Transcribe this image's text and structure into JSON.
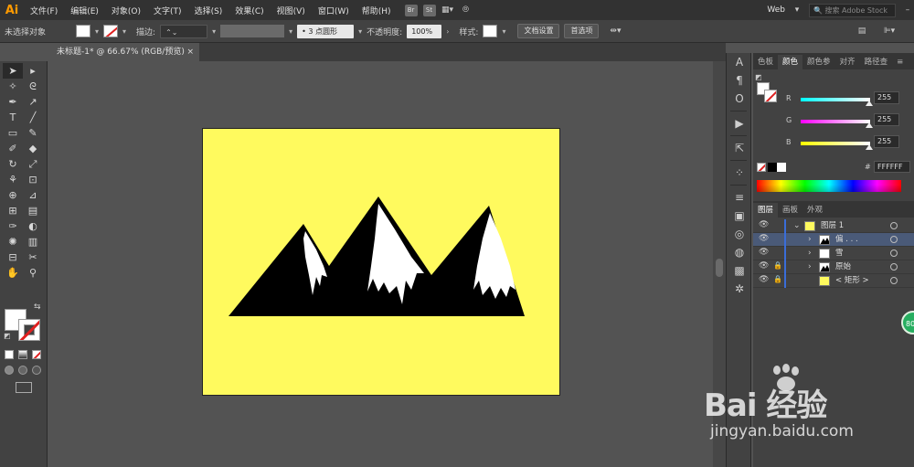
{
  "menubar": {
    "logo": "Ai",
    "items": [
      "文件(F)",
      "编辑(E)",
      "对象(O)",
      "文字(T)",
      "选择(S)",
      "效果(C)",
      "视图(V)",
      "窗口(W)",
      "帮助(H)"
    ],
    "bridge": "Br",
    "stock": "St",
    "workspace": "Web",
    "search_placeholder": "搜索 Adobe Stock"
  },
  "control_bar": {
    "selection_status": "未选择对象",
    "stroke_label": "描边:",
    "brush_value": "3 点圆形",
    "opacity_label": "不透明度:",
    "opacity_value": "100%",
    "style_label": "样式:",
    "doc_setup_button": "文档设置",
    "preferences_button": "首选项"
  },
  "document": {
    "tab_title": "未标题-1* @ 66.67% (RGB/预览)",
    "close_glyph": "×",
    "artboard_color": "#fffa5e",
    "shape_color": "#000000",
    "snow_color": "#ffffff"
  },
  "color_panel": {
    "tabs": [
      "色板",
      "颜色",
      "颜色参",
      "对齐",
      "路径查"
    ],
    "active_tab": "颜色",
    "channels": [
      {
        "label": "R",
        "value": "255",
        "track": "linear-gradient(to right,#00ffff,#ffffff)"
      },
      {
        "label": "G",
        "value": "255",
        "track": "linear-gradient(to right,#ff00ff,#ffffff)"
      },
      {
        "label": "B",
        "value": "255",
        "track": "linear-gradient(to right,#ffff00,#ffffff)"
      }
    ],
    "hex_label": "#",
    "hex_value": "FFFFFF"
  },
  "layers_panel": {
    "tabs": [
      "图层",
      "画板",
      "外观"
    ],
    "active_tab": "图层",
    "rows": [
      {
        "name": "图层 1",
        "indent": 0,
        "expanded": true,
        "locked": false,
        "selected": false
      },
      {
        "name": "偏 . . .",
        "indent": 1,
        "expanded": false,
        "locked": false,
        "selected": true
      },
      {
        "name": "雪",
        "indent": 1,
        "expanded": false,
        "locked": false,
        "selected": false
      },
      {
        "name": "原始",
        "indent": 1,
        "expanded": false,
        "locked": true,
        "selected": false
      },
      {
        "name": "< 矩形 >",
        "indent": 1,
        "expanded": false,
        "locked": true,
        "selected": false
      }
    ]
  },
  "badge": "80",
  "watermark": {
    "main": "Bai 经验",
    "sub": "jingyan.baidu.com"
  }
}
